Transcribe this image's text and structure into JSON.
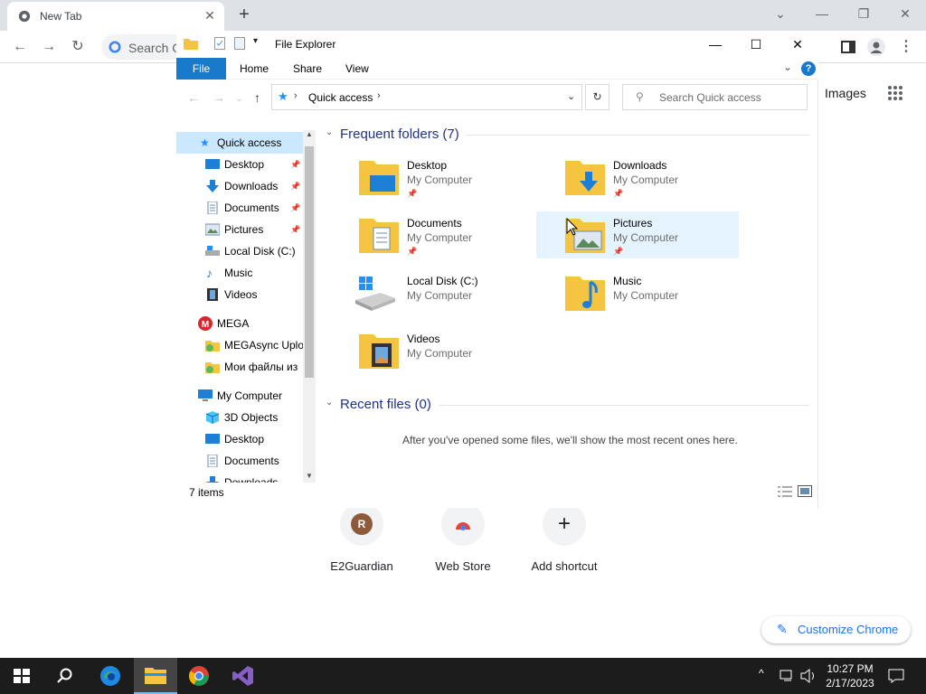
{
  "chrome": {
    "tab_title": "New Tab",
    "omnibox_placeholder": "Search G",
    "images_link": "Images"
  },
  "ntp": {
    "shortcuts": [
      {
        "label": "E2Guardian",
        "initial": "R"
      },
      {
        "label": "Web Store"
      },
      {
        "label": "Add shortcut"
      }
    ],
    "customize_label": "Customize Chrome"
  },
  "explorer": {
    "title": "File Explorer",
    "ribbon": {
      "file": "File",
      "home": "Home",
      "share": "Share",
      "view": "View",
      "help": "?"
    },
    "address": "Quick access",
    "search_placeholder": "Search Quick access",
    "nav": {
      "quick_access": "Quick access",
      "qa_items": [
        "Desktop",
        "Downloads",
        "Documents",
        "Pictures",
        "Local Disk (C:)",
        "Music",
        "Videos"
      ],
      "mega": "MEGA",
      "mega_items": [
        "MEGAsync Uplo",
        "Мои файлы из"
      ],
      "my_computer": "My Computer",
      "mc_items": [
        "3D Objects",
        "Desktop",
        "Documents",
        "Downloads"
      ]
    },
    "frequent_header": "Frequent folders (7)",
    "folders": [
      {
        "name": "Desktop",
        "sub": "My Computer",
        "pinned": true
      },
      {
        "name": "Downloads",
        "sub": "My Computer",
        "pinned": true
      },
      {
        "name": "Documents",
        "sub": "My Computer",
        "pinned": true
      },
      {
        "name": "Pictures",
        "sub": "My Computer",
        "pinned": true
      },
      {
        "name": "Local Disk (C:)",
        "sub": "My Computer",
        "pinned": false
      },
      {
        "name": "Music",
        "sub": "My Computer",
        "pinned": false
      },
      {
        "name": "Videos",
        "sub": "My Computer",
        "pinned": false
      }
    ],
    "recent_header": "Recent files (0)",
    "recent_message": "After you've opened some files, we'll show the most recent ones here.",
    "status": "7 items"
  },
  "taskbar": {
    "time": "10:27 PM",
    "date": "2/17/2023"
  },
  "colors": {
    "accent": "#1979ca",
    "selection": "#cce8ff",
    "hover": "#e5f3ff",
    "taskbar": "#1c1c1c"
  }
}
